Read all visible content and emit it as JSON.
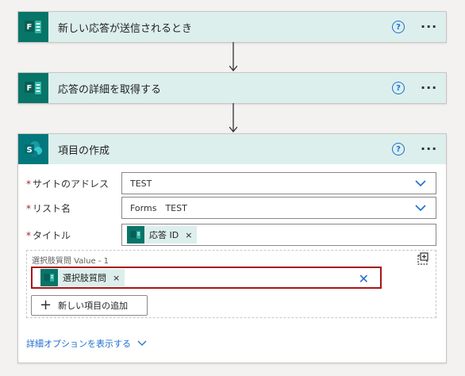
{
  "steps": [
    {
      "title": "新しい応答が送信されるとき",
      "icon": "forms-icon"
    },
    {
      "title": "応答の詳細を取得する",
      "icon": "forms-icon"
    },
    {
      "title": "項目の作成",
      "icon": "sharepoint-icon"
    }
  ],
  "help_glyph": "?",
  "more_glyph": "···",
  "required_mark": "*",
  "fields": {
    "site_address": {
      "label": "サイトのアドレス",
      "value": "TEST"
    },
    "list_name": {
      "label": "リスト名",
      "value": "Forms　TEST"
    },
    "title": {
      "label": "タイトル",
      "token": "応答 ID",
      "remove": "×"
    }
  },
  "array_field": {
    "label": "選択肢質問 Value - 1",
    "token": "選択肢質問",
    "remove": "×",
    "clear": "✕"
  },
  "add_item_button": {
    "plus": "+",
    "label": "新しい項目の追加"
  },
  "advanced_options_link": "詳細オプションを表示する",
  "colors": {
    "header_bg": "#dcefed",
    "forms_green": "#077568",
    "accent_blue": "#1e6fd0",
    "highlight_red": "#a4161a"
  }
}
